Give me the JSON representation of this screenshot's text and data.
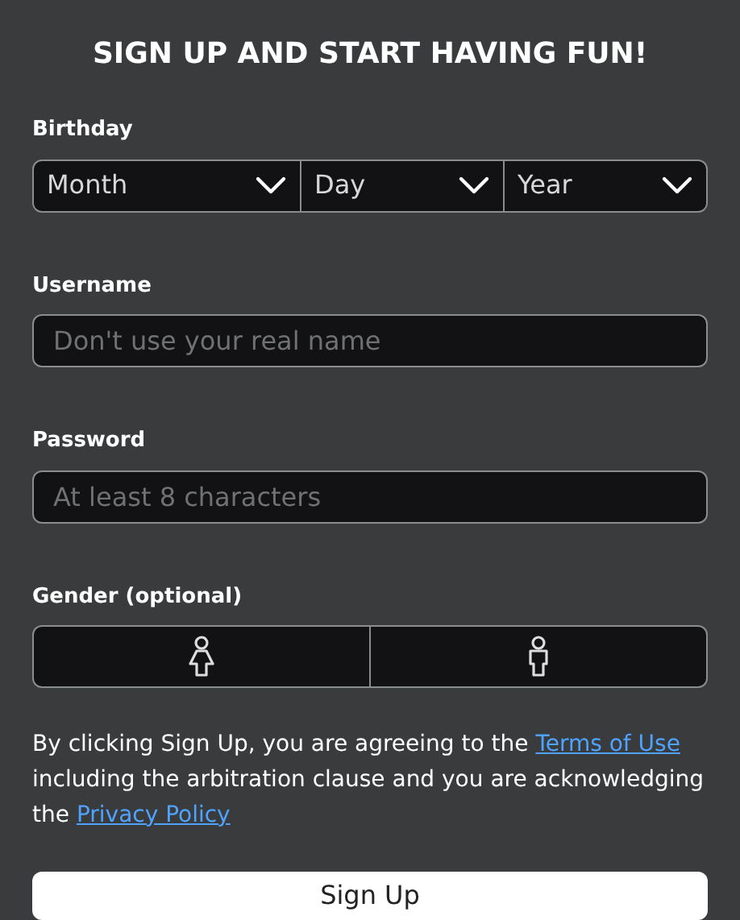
{
  "title": "SIGN UP AND START HAVING FUN!",
  "birthday": {
    "label": "Birthday",
    "selects": [
      {
        "value": "Month"
      },
      {
        "value": "Day"
      },
      {
        "value": "Year"
      }
    ]
  },
  "username": {
    "label": "Username",
    "placeholder": "Don't use your real name"
  },
  "password": {
    "label": "Password",
    "placeholder": "At least 8 characters"
  },
  "gender": {
    "label": "Gender (optional)",
    "options": [
      {
        "kind": "female",
        "selected": false
      },
      {
        "kind": "male",
        "selected": false
      }
    ]
  },
  "terms": {
    "parts": [
      {
        "kind": "text",
        "text": "By clicking Sign Up, you are agreeing to the "
      },
      {
        "kind": "link",
        "text": "Terms of Use"
      },
      {
        "kind": "text",
        "text": " including the arbitration clause and you are acknowledging the "
      },
      {
        "kind": "link",
        "text": "Privacy Policy"
      }
    ]
  },
  "submit": "Sign Up"
}
